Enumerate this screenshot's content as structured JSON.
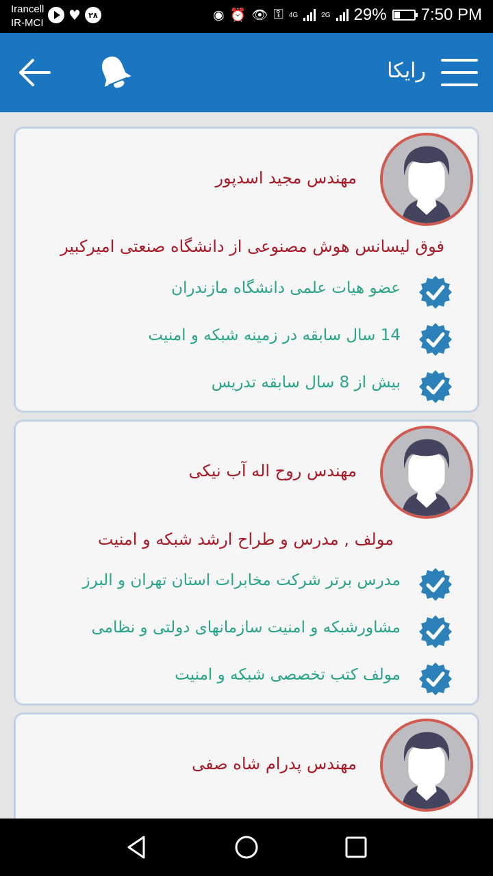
{
  "status_bar": {
    "carrier_1": "Irancell",
    "carrier_2": "IR-MCI",
    "badge_number": "۲۸",
    "network_1": "4G",
    "network_2": "2G",
    "battery": "29%",
    "battery_level": 0.29,
    "time": "7:50 PM"
  },
  "app_bar": {
    "title": "رایکا",
    "back_icon": "arrow-left-icon",
    "notification_icon": "bell-icon",
    "menu_icon": "hamburger-menu-icon",
    "background": "#1b76c2"
  },
  "teachers": [
    {
      "name": "مهندس مجید اسدپور",
      "degree": "فوق لیسانس هوش مصنوعی از دانشگاه صنعتی امیرکبیر",
      "features": [
        "عضو هیات علمی دانشگاه مازندران",
        "14 سال سابقه در زمینه شبکه و امنیت",
        "بیش از 8 سال سابقه تدریس"
      ]
    },
    {
      "name": "مهندس روح اله آب نیکی",
      "degree": "مولف , مدرس و طراح ارشد شبکه و امنیت",
      "features": [
        "مدرس برتر شرکت مخابرات استان تهران و البرز",
        "مشاورشبکه و امنیت سازمانهای دولتی و نظامی",
        "مولف کتب تخصصی شبکه و امنیت"
      ]
    },
    {
      "name": "مهندس پدرام شاه صفی"
    }
  ],
  "colors": {
    "name_text": "#a81b28",
    "feature_text": "#2aa488",
    "check_badge": "#2c82b8",
    "avatar_border": "#d15a50"
  }
}
